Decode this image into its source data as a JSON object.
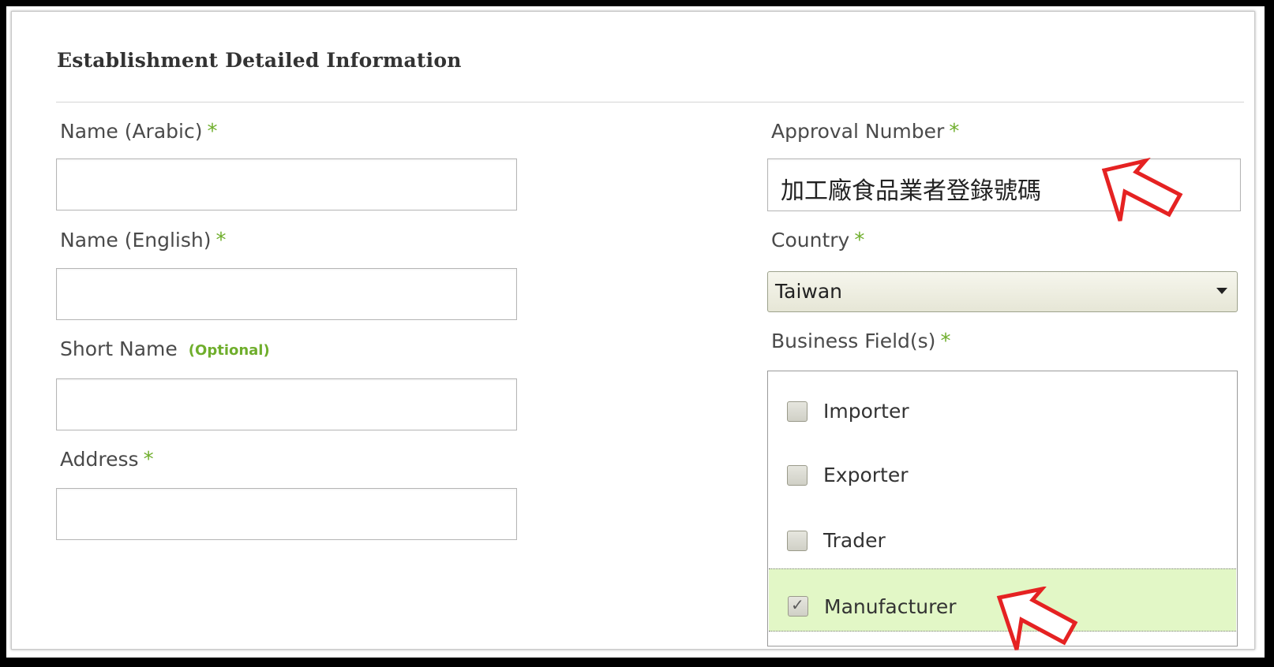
{
  "section": {
    "title": "Establishment Detailed Information"
  },
  "required_marker": "*",
  "left_fields": {
    "name_arabic": {
      "label": "Name (Arabic)",
      "value": ""
    },
    "name_english": {
      "label": "Name (English)",
      "value": ""
    },
    "short_name": {
      "label": "Short Name",
      "optional_tag": "(Optional)",
      "value": ""
    },
    "address": {
      "label": "Address",
      "value": ""
    }
  },
  "right_fields": {
    "approval_number": {
      "label": "Approval Number",
      "value": "加工廠食品業者登錄號碼"
    },
    "country": {
      "label": "Country",
      "selected": "Taiwan"
    },
    "business_fields": {
      "label": "Business Field(s)",
      "options": [
        {
          "label": "Importer",
          "checked": false
        },
        {
          "label": "Exporter",
          "checked": false
        },
        {
          "label": "Trader",
          "checked": false
        },
        {
          "label": "Manufacturer",
          "checked": true
        }
      ]
    }
  },
  "colors": {
    "required_green": "#6fae2c",
    "checked_row_bg": "#e2f7c6",
    "annotation_arrow": "#e52222"
  },
  "icons": [
    "dropdown-caret-icon",
    "checkmark-icon",
    "annotation-arrow-icon"
  ]
}
